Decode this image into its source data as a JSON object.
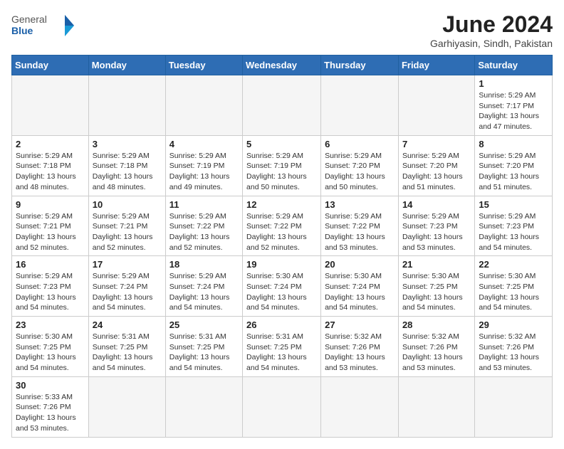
{
  "logo": {
    "text_general": "General",
    "text_blue": "Blue"
  },
  "header": {
    "month_year": "June 2024",
    "location": "Garhiyasin, Sindh, Pakistan"
  },
  "weekdays": [
    "Sunday",
    "Monday",
    "Tuesday",
    "Wednesday",
    "Thursday",
    "Friday",
    "Saturday"
  ],
  "days": {
    "d1": {
      "num": "1",
      "info": "Sunrise: 5:29 AM\nSunset: 7:17 PM\nDaylight: 13 hours and 47 minutes."
    },
    "d2": {
      "num": "2",
      "info": "Sunrise: 5:29 AM\nSunset: 7:18 PM\nDaylight: 13 hours and 48 minutes."
    },
    "d3": {
      "num": "3",
      "info": "Sunrise: 5:29 AM\nSunset: 7:18 PM\nDaylight: 13 hours and 48 minutes."
    },
    "d4": {
      "num": "4",
      "info": "Sunrise: 5:29 AM\nSunset: 7:19 PM\nDaylight: 13 hours and 49 minutes."
    },
    "d5": {
      "num": "5",
      "info": "Sunrise: 5:29 AM\nSunset: 7:19 PM\nDaylight: 13 hours and 50 minutes."
    },
    "d6": {
      "num": "6",
      "info": "Sunrise: 5:29 AM\nSunset: 7:20 PM\nDaylight: 13 hours and 50 minutes."
    },
    "d7": {
      "num": "7",
      "info": "Sunrise: 5:29 AM\nSunset: 7:20 PM\nDaylight: 13 hours and 51 minutes."
    },
    "d8": {
      "num": "8",
      "info": "Sunrise: 5:29 AM\nSunset: 7:20 PM\nDaylight: 13 hours and 51 minutes."
    },
    "d9": {
      "num": "9",
      "info": "Sunrise: 5:29 AM\nSunset: 7:21 PM\nDaylight: 13 hours and 52 minutes."
    },
    "d10": {
      "num": "10",
      "info": "Sunrise: 5:29 AM\nSunset: 7:21 PM\nDaylight: 13 hours and 52 minutes."
    },
    "d11": {
      "num": "11",
      "info": "Sunrise: 5:29 AM\nSunset: 7:22 PM\nDaylight: 13 hours and 52 minutes."
    },
    "d12": {
      "num": "12",
      "info": "Sunrise: 5:29 AM\nSunset: 7:22 PM\nDaylight: 13 hours and 52 minutes."
    },
    "d13": {
      "num": "13",
      "info": "Sunrise: 5:29 AM\nSunset: 7:22 PM\nDaylight: 13 hours and 53 minutes."
    },
    "d14": {
      "num": "14",
      "info": "Sunrise: 5:29 AM\nSunset: 7:23 PM\nDaylight: 13 hours and 53 minutes."
    },
    "d15": {
      "num": "15",
      "info": "Sunrise: 5:29 AM\nSunset: 7:23 PM\nDaylight: 13 hours and 54 minutes."
    },
    "d16": {
      "num": "16",
      "info": "Sunrise: 5:29 AM\nSunset: 7:23 PM\nDaylight: 13 hours and 54 minutes."
    },
    "d17": {
      "num": "17",
      "info": "Sunrise: 5:29 AM\nSunset: 7:24 PM\nDaylight: 13 hours and 54 minutes."
    },
    "d18": {
      "num": "18",
      "info": "Sunrise: 5:29 AM\nSunset: 7:24 PM\nDaylight: 13 hours and 54 minutes."
    },
    "d19": {
      "num": "19",
      "info": "Sunrise: 5:30 AM\nSunset: 7:24 PM\nDaylight: 13 hours and 54 minutes."
    },
    "d20": {
      "num": "20",
      "info": "Sunrise: 5:30 AM\nSunset: 7:24 PM\nDaylight: 13 hours and 54 minutes."
    },
    "d21": {
      "num": "21",
      "info": "Sunrise: 5:30 AM\nSunset: 7:25 PM\nDaylight: 13 hours and 54 minutes."
    },
    "d22": {
      "num": "22",
      "info": "Sunrise: 5:30 AM\nSunset: 7:25 PM\nDaylight: 13 hours and 54 minutes."
    },
    "d23": {
      "num": "23",
      "info": "Sunrise: 5:30 AM\nSunset: 7:25 PM\nDaylight: 13 hours and 54 minutes."
    },
    "d24": {
      "num": "24",
      "info": "Sunrise: 5:31 AM\nSunset: 7:25 PM\nDaylight: 13 hours and 54 minutes."
    },
    "d25": {
      "num": "25",
      "info": "Sunrise: 5:31 AM\nSunset: 7:25 PM\nDaylight: 13 hours and 54 minutes."
    },
    "d26": {
      "num": "26",
      "info": "Sunrise: 5:31 AM\nSunset: 7:25 PM\nDaylight: 13 hours and 54 minutes."
    },
    "d27": {
      "num": "27",
      "info": "Sunrise: 5:32 AM\nSunset: 7:26 PM\nDaylight: 13 hours and 53 minutes."
    },
    "d28": {
      "num": "28",
      "info": "Sunrise: 5:32 AM\nSunset: 7:26 PM\nDaylight: 13 hours and 53 minutes."
    },
    "d29": {
      "num": "29",
      "info": "Sunrise: 5:32 AM\nSunset: 7:26 PM\nDaylight: 13 hours and 53 minutes."
    },
    "d30": {
      "num": "30",
      "info": "Sunrise: 5:33 AM\nSunset: 7:26 PM\nDaylight: 13 hours and 53 minutes."
    }
  }
}
